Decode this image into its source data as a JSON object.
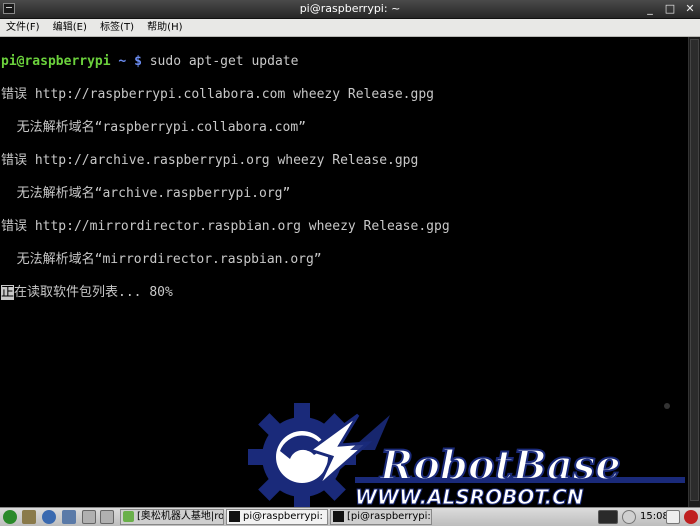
{
  "window": {
    "title": "pi@raspberrypi: ~",
    "controls": {
      "minimize": "_",
      "maximize": "□",
      "close": "✕"
    }
  },
  "menubar": {
    "items": [
      "文件(F)",
      "编辑(E)",
      "标签(T)",
      "帮助(H)"
    ]
  },
  "terminal": {
    "prompt_user": "pi@raspberrypi",
    "prompt_path": "~",
    "prompt_symbol": "$",
    "command": "sudo apt-get update",
    "lines": [
      "错误 http://raspberrypi.collabora.com wheezy Release.gpg",
      "  无法解析域名“raspberrypi.collabora.com”",
      "错误 http://archive.raspberrypi.org wheezy Release.gpg",
      "  无法解析域名“archive.raspberrypi.org”",
      "错误 http://mirrordirector.raspbian.org wheezy Release.gpg",
      "  无法解析域名“mirrordirector.raspbian.org”"
    ],
    "cursor_char": "正",
    "status_text": "在读取软件包列表... 80%"
  },
  "watermark": {
    "brand": "RobotBase",
    "site": "WWW.ALSROBOT.CN"
  },
  "taskbar": {
    "tasks": [
      {
        "label": "[奥松机器人基地|ro...",
        "icon": "browser-icon",
        "active": false
      },
      {
        "label": "pi@raspberrypi: ~",
        "icon": "terminal-icon",
        "active": true
      },
      {
        "label": "[pi@raspberrypi: ~]",
        "icon": "terminal-icon",
        "active": false
      }
    ],
    "clock": "15:08"
  },
  "colors": {
    "prompt_user": "#6bd13c",
    "prompt_path": "#6b8cf0",
    "terminal_text": "#c8c8c8",
    "terminal_bg": "#000000",
    "watermark_blue": "#1a2a7a"
  }
}
